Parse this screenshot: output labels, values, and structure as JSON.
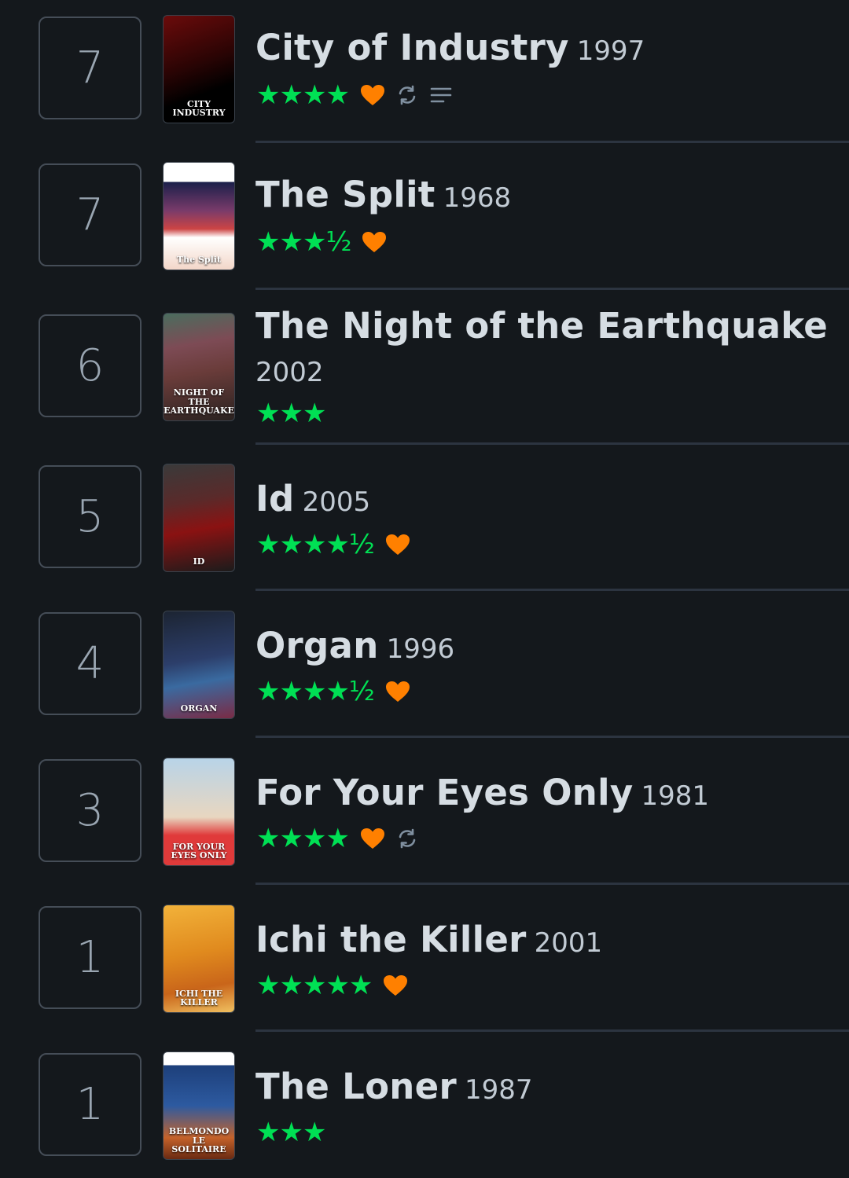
{
  "colors": {
    "background": "#14181c",
    "star": "#00e054",
    "heart": "#ff8000",
    "divider": "#2c3440",
    "icon_muted": "#8090a0"
  },
  "items": [
    {
      "rank": "7",
      "title": "City of Industry",
      "year": "1997",
      "stars": "★★★★",
      "liked": true,
      "rewatch": true,
      "review": true,
      "poster_text": "CITY INDUSTRY",
      "poster_bg": "linear-gradient(160deg,#6b0b0b,#2a0404 45%,#000 70%)"
    },
    {
      "rank": "7",
      "title": "The Split",
      "year": "1968",
      "stars": "★★★½",
      "liked": true,
      "rewatch": false,
      "review": false,
      "poster_text": "The Split",
      "poster_bg": "linear-gradient(180deg,#fff 0,#fff 18%,#1a1f4a 18%,#7a3b6a 45%,#c44 62%,#fff 70%,#f3d7c9 100%)"
    },
    {
      "rank": "6",
      "title": "The Night of the Earthquake",
      "year": "2002",
      "stars": "★★★",
      "liked": false,
      "rewatch": false,
      "review": false,
      "poster_text": "NIGHT OF THE EARTHQUAKE",
      "poster_bg": "linear-gradient(170deg,#4a6d5e 0,#7d4b55 30%,#6a3c3a 55%,#2a2220 100%)"
    },
    {
      "rank": "5",
      "title": "Id",
      "year": "2005",
      "stars": "★★★★½",
      "liked": true,
      "rewatch": false,
      "review": false,
      "poster_text": "ID",
      "poster_bg": "linear-gradient(170deg,#3a3a3a 0,#5a2a2a 35%,#8a1212 60%,#1b1b1b 100%)"
    },
    {
      "rank": "4",
      "title": "Organ",
      "year": "1996",
      "stars": "★★★★½",
      "liked": true,
      "rewatch": false,
      "review": false,
      "poster_text": "ORGAN",
      "poster_bg": "linear-gradient(170deg,#1c2432 0,#2c3e6a 45%,#3a6aa0 65%,#7a2b45 100%)"
    },
    {
      "rank": "3",
      "title": "For Your Eyes Only",
      "year": "1981",
      "stars": "★★★★",
      "liked": true,
      "rewatch": true,
      "review": false,
      "poster_text": "FOR YOUR EYES ONLY",
      "poster_bg": "linear-gradient(180deg,#b8d4e8 0,#e8d6c0 55%,#e03a3a 72%,#e03a3a 100%)"
    },
    {
      "rank": "1",
      "title": "Ichi the Killer",
      "year": "2001",
      "stars": "★★★★★",
      "liked": true,
      "rewatch": false,
      "review": false,
      "poster_text": "ICHI THE KILLER",
      "poster_bg": "linear-gradient(170deg,#f2b23a 0,#e08a1e 45%,#c9651a 75%,#f0c060 100%)"
    },
    {
      "rank": "1",
      "title": "The Loner",
      "year": "1987",
      "stars": "★★★",
      "liked": false,
      "rewatch": false,
      "review": false,
      "poster_text": "BELMONDO LE SOLITAIRE",
      "poster_bg": "linear-gradient(180deg,#fff 0,#fff 12%,#1d3f7a 12%,#2d5aa0 50%,#c4622a 80%,#6a2a12 100%)"
    }
  ]
}
